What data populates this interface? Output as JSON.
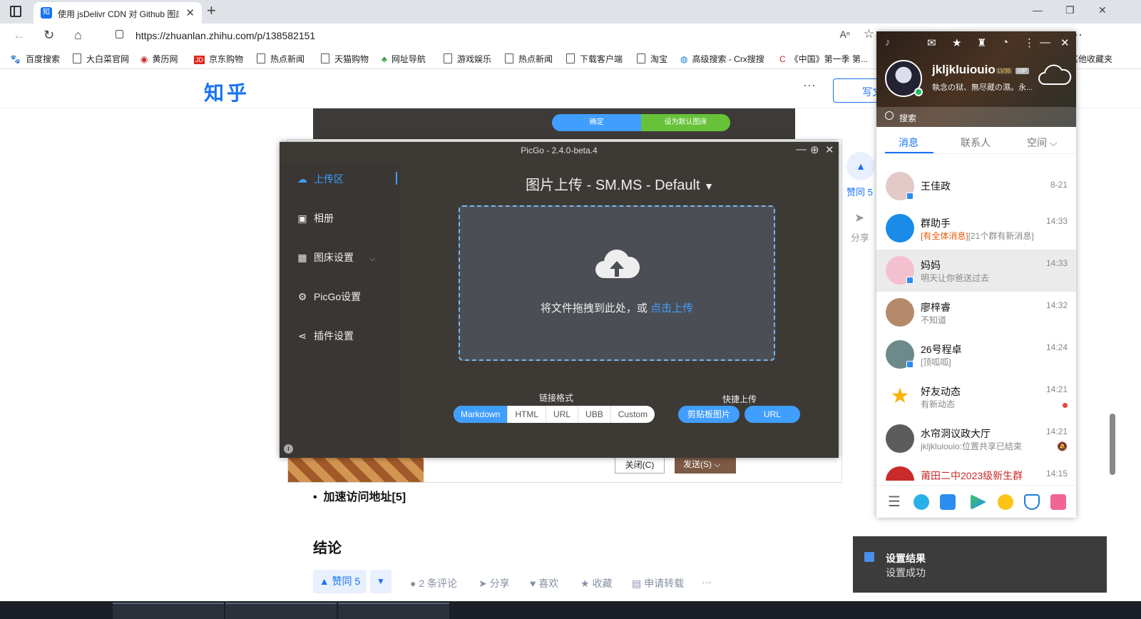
{
  "browser": {
    "tab_title": "使用 jsDelivr CDN 对 Github 图床",
    "tab_favicon": "知",
    "url": "https://zhuanlan.zhihu.com/p/138582151",
    "reader_icon": "A",
    "bookmarks": [
      "百度搜索",
      "大白菜官网",
      "黄历网",
      "京东购物",
      "热点新闻",
      "天猫购物",
      "网址导航",
      "游戏娱乐",
      "热点新闻",
      "下载客户端",
      "淘宝",
      "高级搜索 - Crx搜搜",
      "《中国》第一季 第...",
      "其他收藏夹"
    ]
  },
  "zhihu": {
    "logo": "知乎",
    "write_label": "写文",
    "bg_confirm": "确定",
    "bg_set_default": "设为默认图床",
    "bg_close": "关闭(C)",
    "bg_send": "发送(S)",
    "side_vote": "赞同 5",
    "side_share": "分享",
    "bullet_text": "加速访问地址[5]",
    "conclusion": "结论",
    "upvote": "▲ 赞同 5",
    "actions": [
      "2 条评论",
      "分享",
      "喜欢",
      "收藏",
      "申请转载",
      "···"
    ]
  },
  "picgo": {
    "title": "PicGo - 2.4.0-beta.4",
    "nav": [
      "上传区",
      "相册",
      "图床设置",
      "PicGo设置",
      "插件设置"
    ],
    "heading": "图片上传 - SM.MS - Default",
    "drop_text": "将文件拖拽到此处，或 ",
    "drop_link": "点击上传",
    "link_format_label": "链接格式",
    "formats": [
      "Markdown",
      "HTML",
      "URL",
      "UBB",
      "Custom"
    ],
    "quick_upload_label": "快捷上传",
    "quick_buttons": [
      "剪贴板图片",
      "URL"
    ],
    "accent": "#409eff"
  },
  "qq": {
    "nickname": "jkljkluiouio",
    "level_badge": "LV35",
    "vip_badge": "VIP",
    "signature": "執念の狱、無尽蔵の濕。永...",
    "search_placeholder": "搜索",
    "tabs": [
      "消息",
      "联系人",
      "空间 ⌵"
    ],
    "conversations": [
      {
        "name": "王佳政",
        "preview": "",
        "time": "8-21",
        "avatar": "#e4c9c9"
      },
      {
        "name": "群助手",
        "preview_highlight": "[有全体消息]",
        "preview": "[21个群有新消息]",
        "time": "14:33",
        "avatar": "#1a8ce8"
      },
      {
        "name": "妈妈",
        "preview": "明天让你爸送过去",
        "time": "14:33",
        "avatar": "#f4c0d0"
      },
      {
        "name": "廖梓睿",
        "preview": "不知道",
        "time": "14:32",
        "avatar": "#b58a6a"
      },
      {
        "name": "26号程卓",
        "preview": "[顶呱呱]",
        "time": "14:24",
        "avatar": "#6c8a8a"
      },
      {
        "name": "好友动态",
        "preview": "有新动态",
        "time": "14:21",
        "avatar": "#ffd43b"
      },
      {
        "name": "水帘洞议政大厅",
        "preview": "jkljkluiouio:位置共享已结束",
        "time": "14:21",
        "avatar": "#5c5c5c"
      },
      {
        "name": "莆田二中2023级新生群",
        "preview": "",
        "time": "14:15",
        "avatar": "#c92a2a"
      }
    ]
  },
  "toast": {
    "title": "设置结果",
    "body": "设置成功"
  }
}
